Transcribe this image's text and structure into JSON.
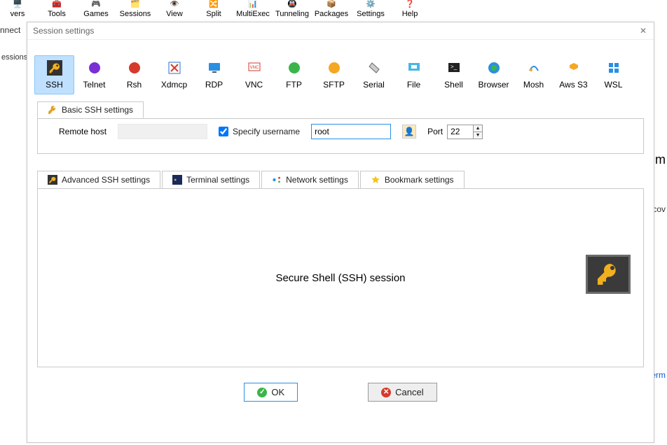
{
  "main_toolbar": [
    {
      "label": "vers",
      "icon": "🖥️"
    },
    {
      "label": "Tools",
      "icon": "🧰"
    },
    {
      "label": "Games",
      "icon": "🎮"
    },
    {
      "label": "Sessions",
      "icon": "🗂️"
    },
    {
      "label": "View",
      "icon": "👁️"
    },
    {
      "label": "Split",
      "icon": "🔀"
    },
    {
      "label": "MultiExec",
      "icon": "📊"
    },
    {
      "label": "Tunneling",
      "icon": "🚇"
    },
    {
      "label": "Packages",
      "icon": "📦"
    },
    {
      "label": "Settings",
      "icon": "⚙️"
    },
    {
      "label": "Help",
      "icon": "❓"
    }
  ],
  "bg": {
    "connect": "nnect",
    "sessions": "essions",
    "m_letter": "m",
    "cov": "cov",
    "term": "erm"
  },
  "dialog": {
    "title": "Session settings",
    "close": "✕"
  },
  "session_types": [
    {
      "label": "SSH",
      "icon": "key",
      "selected": true
    },
    {
      "label": "Telnet",
      "icon": "globe-purple"
    },
    {
      "label": "Rsh",
      "icon": "globe-red"
    },
    {
      "label": "Xdmcp",
      "icon": "x"
    },
    {
      "label": "RDP",
      "icon": "monitor-blue"
    },
    {
      "label": "VNC",
      "icon": "vnc"
    },
    {
      "label": "FTP",
      "icon": "globe-green"
    },
    {
      "label": "SFTP",
      "icon": "globe-orange"
    },
    {
      "label": "Serial",
      "icon": "serial"
    },
    {
      "label": "File",
      "icon": "file-monitor"
    },
    {
      "label": "Shell",
      "icon": "shell"
    },
    {
      "label": "Browser",
      "icon": "globe-browser"
    },
    {
      "label": "Mosh",
      "icon": "mosh"
    },
    {
      "label": "Aws S3",
      "icon": "aws"
    },
    {
      "label": "WSL",
      "icon": "wsl"
    }
  ],
  "basic": {
    "tab": "Basic SSH settings",
    "remote_host": "Remote host",
    "specify_user": "Specify username",
    "user_value": "root",
    "port_label": "Port",
    "port_value": "22",
    "host_value": ""
  },
  "sub_tabs": [
    {
      "label": "Advanced SSH settings",
      "icon": "key"
    },
    {
      "label": "Terminal settings",
      "icon": "term"
    },
    {
      "label": "Network settings",
      "icon": "net"
    },
    {
      "label": "Bookmark settings",
      "icon": "star"
    }
  ],
  "adv": {
    "desc": "Secure Shell (SSH) session"
  },
  "buttons": {
    "ok": "OK",
    "cancel": "Cancel"
  }
}
